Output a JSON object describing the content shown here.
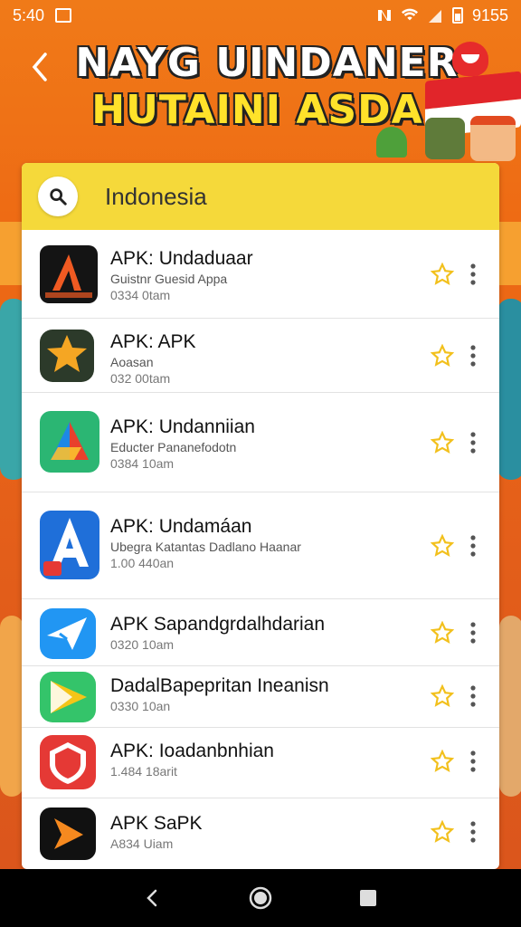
{
  "status_bar": {
    "time": "5:40",
    "right_text": "9155",
    "icons": [
      "image-icon",
      "nfc-icon",
      "wifi-icon",
      "signal-icon",
      "battery-icon"
    ]
  },
  "header": {
    "back_icon": "back-arrow-icon",
    "banner_line1": "NAYG UINDANER",
    "banner_line2": "HUTAINI ASDA!"
  },
  "search": {
    "icon": "search-icon",
    "query": "Indonesia"
  },
  "apps": [
    {
      "title": "APK: Undaduaar",
      "subtitle": "Guistnr Guesid Appa",
      "meta": "0334 0tam",
      "icon_colors": [
        "#1b1b1b",
        "#f05a22"
      ]
    },
    {
      "title": "APK: APK",
      "subtitle": "Aoasan",
      "meta": "032 00tam",
      "icon_colors": [
        "#2c3a2a",
        "#f5a623"
      ]
    },
    {
      "title": "APK: Undanniian",
      "subtitle": "Educter Pananefodotn",
      "meta": "0384 10am",
      "icon_colors": [
        "#2bb673",
        "#e8412c"
      ]
    },
    {
      "title": "APK: Undamáan",
      "subtitle": "Ubegra  Katantas Dadlano Haanar",
      "meta": "1.00 440an",
      "icon_colors": [
        "#1f6fd9",
        "#ffffff"
      ]
    },
    {
      "title": "APK Sapandgrdalhdarian",
      "subtitle": "",
      "meta": "0320 10am",
      "icon_colors": [
        "#2196f3",
        "#ffffff"
      ]
    },
    {
      "title": "DadalBapepritan Ineanisn",
      "subtitle": "",
      "meta": "0330 10an",
      "icon_colors": [
        "#34c46a",
        "#f5c518"
      ]
    },
    {
      "title": "APK: Ioadanbnhian",
      "subtitle": "",
      "meta": "1.484 18arit",
      "icon_colors": [
        "#e53935",
        "#ffffff"
      ]
    },
    {
      "title": "APK SaPK",
      "subtitle": "",
      "meta": "A834 Uiam",
      "icon_colors": [
        "#111111",
        "#f5891f"
      ]
    }
  ],
  "row_icons": {
    "favorite": "star-outline-icon",
    "more": "more-vert-icon"
  },
  "nav_bar": {
    "back": "nav-back-icon",
    "home": "nav-home-icon",
    "recents": "nav-recents-icon"
  }
}
